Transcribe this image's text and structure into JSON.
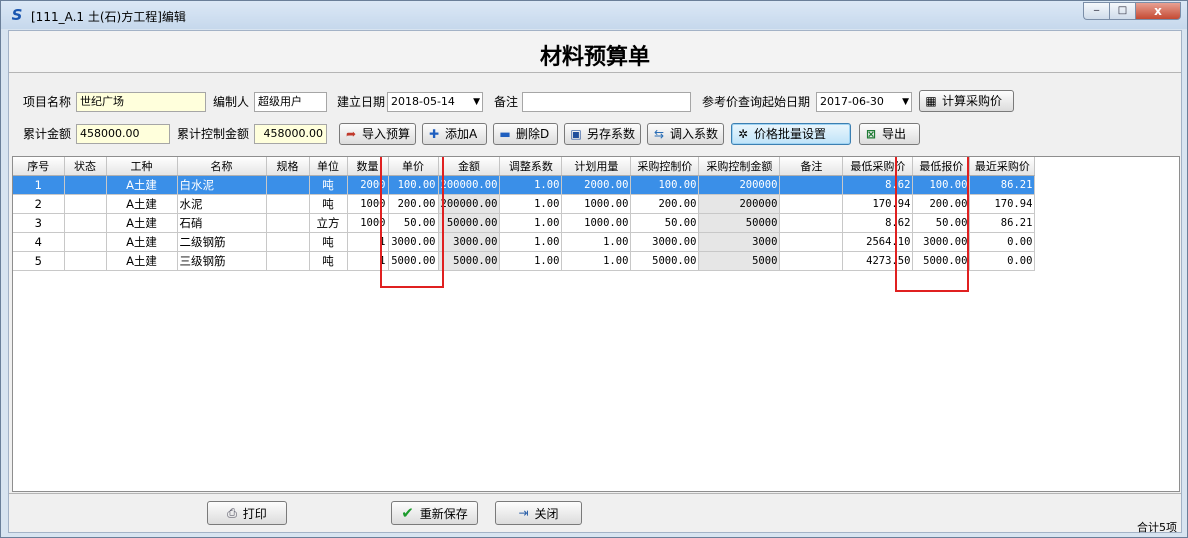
{
  "window": {
    "icon": "app-s-logo-icon",
    "title": "[111_A.1  土(石)方工程]编辑",
    "minimize": "‒",
    "maximize": "□",
    "close": "x"
  },
  "page_title": "材料预算单",
  "form": {
    "project_name_label": "项目名称",
    "project_name": "世纪广场",
    "compiler_label": "编制人",
    "compiler": "超级用户",
    "created_date_label": "建立日期",
    "created_date": "2018-05-14",
    "remark_label": "备注",
    "remark": "",
    "ref_price_date_label": "参考价查询起始日期",
    "ref_price_date": "2017-06-30",
    "total_amount_label": "累计金额",
    "total_amount": "458000.00",
    "total_control_label": "累计控制金额",
    "total_control": "458000.00"
  },
  "buttons": {
    "calc_purchase_price": "计算采购价",
    "import_budget": "导入预算",
    "add": "添加A",
    "delete": "删除D",
    "save_coeff": "另存系数",
    "load_coeff": "调入系数",
    "batch_price": "价格批量设置",
    "export": "导出",
    "print": "打印",
    "resave": "重新保存",
    "close": "关闭"
  },
  "table": {
    "columns": [
      "序号",
      "状态",
      "工种",
      "名称",
      "规格",
      "单位",
      "数量",
      "单价",
      "金额",
      "调整系数",
      "计划用量",
      "采购控制价",
      "采购控制金额",
      "备注",
      "最低采购价",
      "最低报价",
      "最近采购价"
    ],
    "rows": [
      [
        "1",
        "",
        "A土建",
        "白水泥",
        "",
        "吨",
        "2000",
        "100.00",
        "200000.00",
        "1.00",
        "2000.00",
        "100.00",
        "200000",
        "",
        "8.62",
        "100.00",
        "86.21"
      ],
      [
        "2",
        "",
        "A土建",
        "水泥",
        "",
        "吨",
        "1000",
        "200.00",
        "200000.00",
        "1.00",
        "1000.00",
        "200.00",
        "200000",
        "",
        "170.94",
        "200.00",
        "170.94"
      ],
      [
        "3",
        "",
        "A土建",
        "石硝",
        "",
        "立方",
        "1000",
        "50.00",
        "50000.00",
        "1.00",
        "1000.00",
        "50.00",
        "50000",
        "",
        "8.62",
        "50.00",
        "86.21"
      ],
      [
        "4",
        "",
        "A土建",
        "二级钢筋",
        "",
        "吨",
        "1",
        "3000.00",
        "3000.00",
        "1.00",
        "1.00",
        "3000.00",
        "3000",
        "",
        "2564.10",
        "3000.00",
        "0.00"
      ],
      [
        "5",
        "",
        "A土建",
        "三级钢筋",
        "",
        "吨",
        "1",
        "5000.00",
        "5000.00",
        "1.00",
        "1.00",
        "5000.00",
        "5000",
        "",
        "4273.50",
        "5000.00",
        "0.00"
      ]
    ],
    "selected_row": 0
  },
  "footer": {
    "total_items": "合计5项"
  },
  "colors": {
    "selection": "#3a8fe8",
    "highlight_box": "#e02020"
  }
}
